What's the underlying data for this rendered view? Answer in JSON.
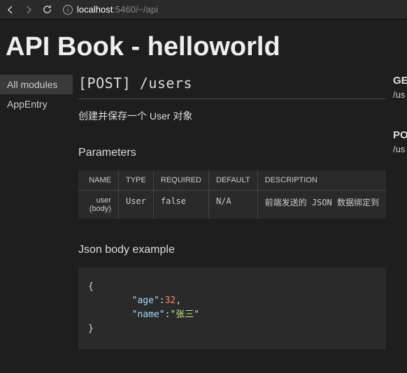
{
  "browser": {
    "url_host": "localhost",
    "url_path": ":5460/~/api"
  },
  "header": {
    "title": "API Book - helloworld"
  },
  "sidebar": {
    "items": [
      {
        "label": "All modules",
        "active": true
      },
      {
        "label": "AppEntry",
        "active": false
      }
    ]
  },
  "endpoint": {
    "title": "[POST]  /users",
    "description": "创建并保存一个 User 对象"
  },
  "parameters": {
    "title": "Parameters",
    "headers": [
      "NAME",
      "TYPE",
      "REQUIRED",
      "DEFAULT",
      "DESCRIPTION"
    ],
    "rows": [
      {
        "name": "user (body)",
        "type": "User",
        "required": "false",
        "default": "N/A",
        "description": "前端发送的 JSON 数据绑定到"
      }
    ]
  },
  "json_example": {
    "title": "Json body example",
    "obj": {
      "age": 32,
      "name": "张三"
    },
    "brace_open": "{",
    "brace_close": "}",
    "indent": "        ",
    "q": "\"",
    "colon": ":",
    "comma": ",",
    "key_age": "age",
    "val_age": "32",
    "key_name": "name",
    "val_name": "\"张三\""
  },
  "right": {
    "items": [
      {
        "method": "GE",
        "path": "/us"
      },
      {
        "method": "PO",
        "path": "/us"
      }
    ]
  }
}
